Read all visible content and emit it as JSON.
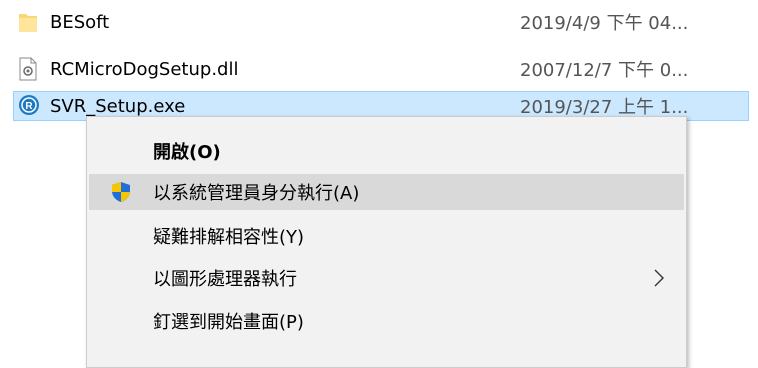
{
  "files": [
    {
      "name": "BESoft",
      "date": "2019/4/9 下午 04...",
      "icon": "folder-icon",
      "selected": false
    },
    {
      "name": "RCMicroDogSetup.dll",
      "date": "2007/12/7 下午 0...",
      "icon": "dll-file-icon",
      "selected": false
    },
    {
      "name": "SVR_Setup.exe",
      "date": "2019/3/27 上午 1...",
      "icon": "app-exe-icon",
      "selected": true
    }
  ],
  "context_menu": {
    "items": [
      {
        "label": "開啟(O)",
        "bold": true
      },
      {
        "label": "以系統管理員身分執行(A)",
        "icon": "uac-shield-icon",
        "highlighted": true
      },
      {
        "label": "疑難排解相容性(Y)"
      },
      {
        "label": "以圖形處理器執行",
        "has_submenu": true
      },
      {
        "label": "釘選到開始畫面(P)"
      }
    ]
  },
  "colors": {
    "selection_bg": "#cce8ff",
    "selection_border": "#99d1ff",
    "menu_bg": "#f2f2f2",
    "menu_highlight": "#d9d9d9",
    "folder": "#f8d775",
    "shield_blue": "#1e6fd9",
    "shield_yellow": "#f7c600"
  }
}
